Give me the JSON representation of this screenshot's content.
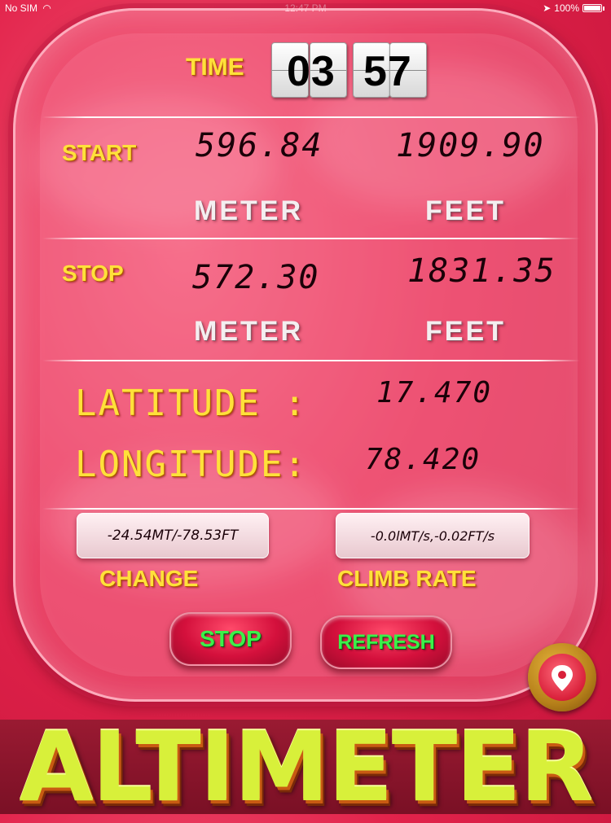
{
  "status_bar": {
    "carrier": "No SIM",
    "wifi_icon": "wifi-icon",
    "time": "12:47 PM",
    "location_icon": "location-arrow-icon",
    "battery": "100%"
  },
  "timer": {
    "label": "TIME",
    "minutes": "03",
    "seconds": "57"
  },
  "start": {
    "label": "START",
    "meter_value": "596.84",
    "feet_value": "1909.90",
    "meter_unit": "METER",
    "feet_unit": "FEET"
  },
  "stop": {
    "label": "STOP",
    "meter_value": "572.30",
    "feet_value": "1831.35",
    "meter_unit": "METER",
    "feet_unit": "FEET"
  },
  "location": {
    "latitude_label": "LATITUDE :",
    "latitude_value": "17.470",
    "longitude_label": "LONGITUDE:",
    "longitude_value": "78.420"
  },
  "change": {
    "value": "-24.54MT/-78.53FT",
    "label": "CHANGE"
  },
  "climb_rate": {
    "value": "-0.0lMT/s,-0.02FT/s",
    "label": "CLIMB RATE"
  },
  "buttons": {
    "stop": "STOP",
    "refresh": "REFRESH"
  },
  "periscope_icon": "periscope-icon",
  "banner": {
    "title": "ALTIMETER"
  },
  "colors": {
    "background": "#e2234b",
    "label_gold": "#ffe13a",
    "button_text": "#3cf04a",
    "banner_text": "#d8f03a"
  }
}
